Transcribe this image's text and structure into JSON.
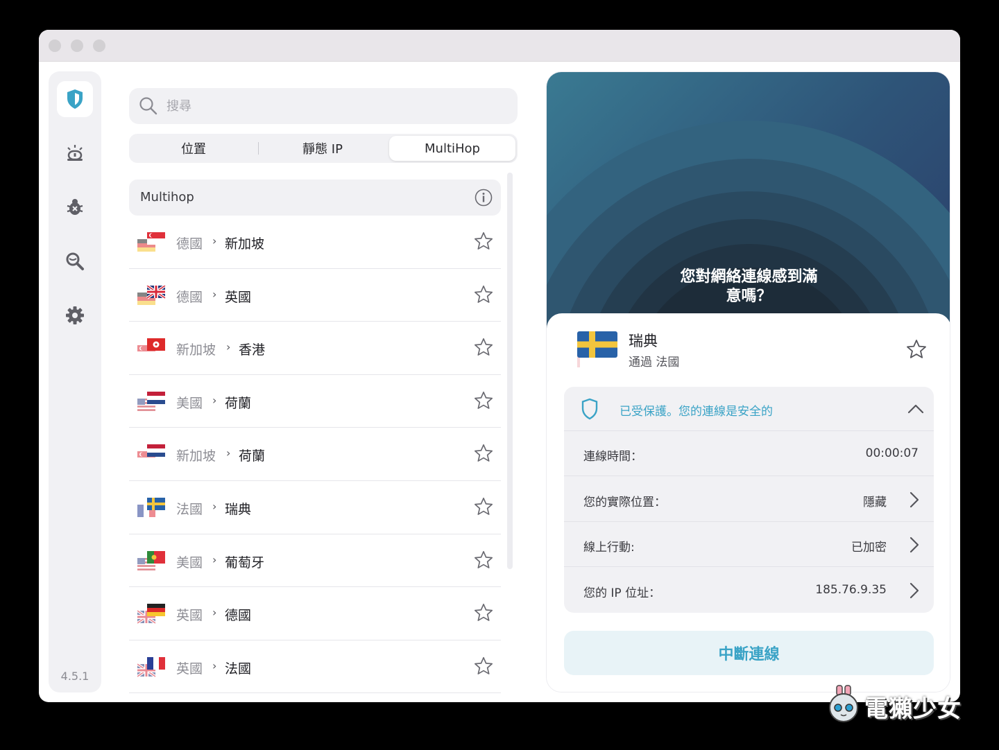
{
  "app": {
    "version": "4.5.1"
  },
  "search": {
    "placeholder": "搜尋"
  },
  "tabs": [
    {
      "label": "位置",
      "active": false
    },
    {
      "label": "靜態 IP",
      "active": false
    },
    {
      "label": "MultiHop",
      "active": true
    }
  ],
  "list": {
    "header": "Multihop",
    "rows": [
      {
        "from": "德國",
        "to": "新加坡",
        "flags": [
          "singapore",
          "germany"
        ]
      },
      {
        "from": "德國",
        "to": "英國",
        "flags": [
          "uk",
          "germany"
        ]
      },
      {
        "from": "新加坡",
        "to": "香港",
        "flags": [
          "hongkong",
          "singapore"
        ]
      },
      {
        "from": "美國",
        "to": "荷蘭",
        "flags": [
          "netherlands",
          "usa"
        ]
      },
      {
        "from": "新加坡",
        "to": "荷蘭",
        "flags": [
          "netherlands",
          "singapore"
        ]
      },
      {
        "from": "法國",
        "to": "瑞典",
        "flags": [
          "sweden",
          "france"
        ]
      },
      {
        "from": "美國",
        "to": "葡萄牙",
        "flags": [
          "portugal",
          "usa"
        ]
      },
      {
        "from": "英國",
        "to": "德國",
        "flags": [
          "germany",
          "uk"
        ]
      },
      {
        "from": "英國",
        "to": "法國",
        "flags": [
          "france",
          "uk"
        ]
      }
    ]
  },
  "hero": {
    "question": "您對網絡連線感到滿\n意嗎？"
  },
  "connection": {
    "country": "瑞典",
    "via": "通過 法國",
    "status": "已受保護。您的連線是安全的",
    "details": [
      {
        "label": "連線時間：",
        "value": "00:00:07",
        "arrow": false
      },
      {
        "label": "您的實際位置：",
        "value": "隱藏",
        "arrow": true
      },
      {
        "label": "線上行動:",
        "value": "已加密",
        "arrow": true
      },
      {
        "label": "您的 IP 位址：",
        "value": "185.76.9.35",
        "arrow": true
      }
    ],
    "disconnect_label": "中斷連線"
  },
  "watermark": {
    "text": "電獺少女"
  },
  "colors": {
    "accent": "#3aa3c6",
    "hero_start": "#3a7a92",
    "hero_end": "#2b3f6a"
  },
  "icons": {
    "sidebar": [
      "shield-icon",
      "alarm-icon",
      "bug-icon",
      "leak-search-icon",
      "gear-icon"
    ]
  }
}
